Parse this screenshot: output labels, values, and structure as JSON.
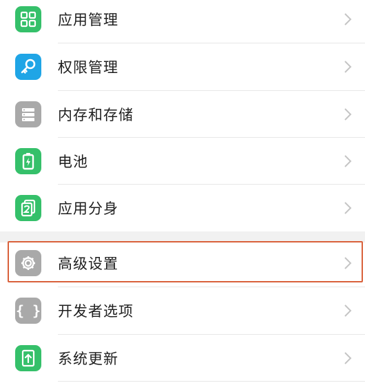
{
  "colors": {
    "green": "#35c06a",
    "blue": "#1fa5e6",
    "gray": "#a9a9a9",
    "highlight": "#d9603a"
  },
  "items": [
    {
      "label": "应用管理",
      "icon": "app-grid-icon"
    },
    {
      "label": "权限管理",
      "icon": "key-icon"
    },
    {
      "label": "内存和存储",
      "icon": "storage-icon"
    },
    {
      "label": "电池",
      "icon": "battery-icon"
    },
    {
      "label": "应用分身",
      "icon": "app-clone-icon"
    },
    {
      "label": "高级设置",
      "icon": "gear-icon"
    },
    {
      "label": "开发者选项",
      "icon": "braces-icon"
    },
    {
      "label": "系统更新",
      "icon": "update-icon"
    }
  ]
}
